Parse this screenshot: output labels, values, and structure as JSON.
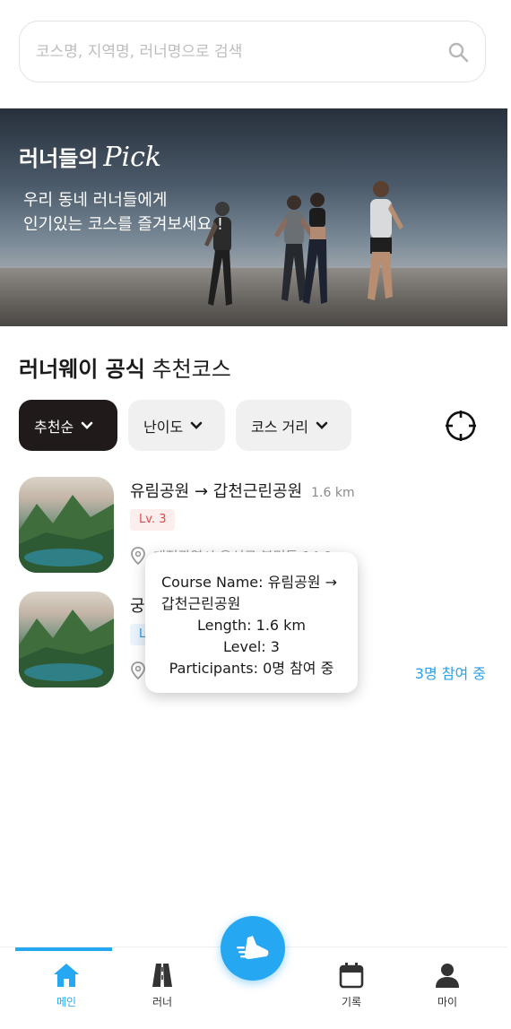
{
  "search": {
    "placeholder": "코스명, 지역명, 러너명으로 검색",
    "icon": "search-icon"
  },
  "banner": {
    "title_prefix": "러너들의",
    "title_script": "Pick",
    "subtitle_line1": "우리 동네 러너들에게",
    "subtitle_line2": "인기있는 코스를 즐겨보세요 !"
  },
  "section": {
    "title_bold": "러너웨이 공식",
    "title_rest": "추천코스"
  },
  "filters": [
    {
      "label": "추천순",
      "active": true
    },
    {
      "label": "난이도",
      "active": false
    },
    {
      "label": "코스 거리",
      "active": false
    }
  ],
  "courses": [
    {
      "name": "유림공원 → 갑천근린공원",
      "length": "1.6 km",
      "level": "Lv. 3",
      "level_color": "#e24a4a",
      "address": "대전광역시 유성구 봉명동 14-1",
      "participants": ""
    },
    {
      "name": "궁",
      "length": "",
      "level": "L",
      "level_color": "#2c9be6",
      "address": "",
      "participants": "3명 참여 중"
    }
  ],
  "tooltip": {
    "course_name": "Course Name: 유림공원 →",
    "course_name_cont": "갑천근린공원",
    "length": "Length: 1.6 km",
    "level": "Level: 3",
    "participants": "Participants: 0명 참여 중"
  },
  "nav": {
    "items": [
      {
        "label": "메인",
        "icon": "home-icon",
        "active": true
      },
      {
        "label": "러너",
        "icon": "road-icon",
        "active": false
      },
      {
        "label": "기록",
        "icon": "calendar-icon",
        "active": false
      },
      {
        "label": "마이",
        "icon": "person-icon",
        "active": false
      }
    ],
    "fab_icon": "running-shoe-icon"
  },
  "colors": {
    "accent": "#25a7f2",
    "dark_chip": "#201a1a",
    "level_red": "#e24a4a"
  }
}
